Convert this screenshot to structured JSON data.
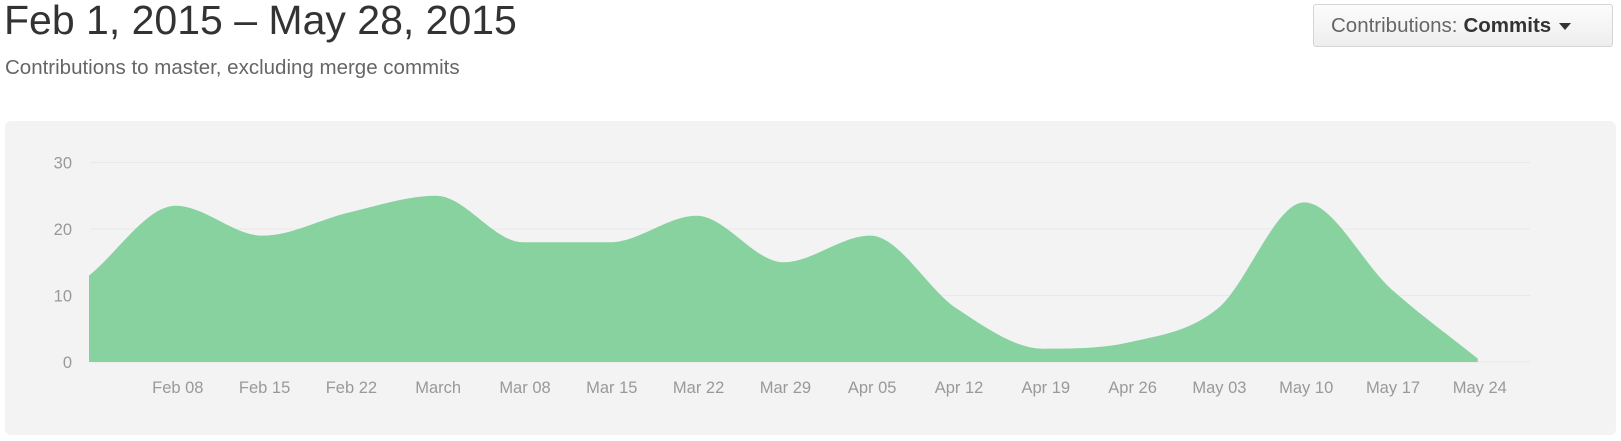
{
  "header": {
    "title": "Feb 1, 2015 – May 28, 2015",
    "subtitle": "Contributions to master, excluding merge commits"
  },
  "contributions_select": {
    "label": "Contributions:",
    "value": "Commits",
    "icon": "caret-down-icon"
  },
  "colors": {
    "area_fill": "#88d2a0",
    "panel_bg": "#f3f3f3",
    "grid": "#e9e9e9",
    "tick_text": "#999999"
  },
  "chart_data": {
    "type": "area",
    "grid": true,
    "ylim": [
      0,
      30
    ],
    "y_ticks": [
      0,
      10,
      20,
      30
    ],
    "x_tick_labels": [
      "Feb 08",
      "Feb 15",
      "Feb 22",
      "March",
      "Mar 08",
      "Mar 15",
      "Mar 22",
      "Mar 29",
      "Apr 05",
      "Apr 12",
      "Apr 19",
      "Apr 26",
      "May 03",
      "May 10",
      "May 17",
      "May 24"
    ],
    "x": [
      "2015-02-01",
      "2015-02-08",
      "2015-02-15",
      "2015-02-22",
      "2015-03-01",
      "2015-03-08",
      "2015-03-15",
      "2015-03-22",
      "2015-03-29",
      "2015-04-05",
      "2015-04-12",
      "2015-04-19",
      "2015-04-26",
      "2015-05-03",
      "2015-05-10",
      "2015-05-17",
      "2015-05-24"
    ],
    "values": [
      13,
      23.5,
      19,
      22.5,
      25,
      18,
      18,
      22,
      15,
      19,
      8,
      2,
      3,
      8,
      24,
      11,
      0.5
    ]
  }
}
